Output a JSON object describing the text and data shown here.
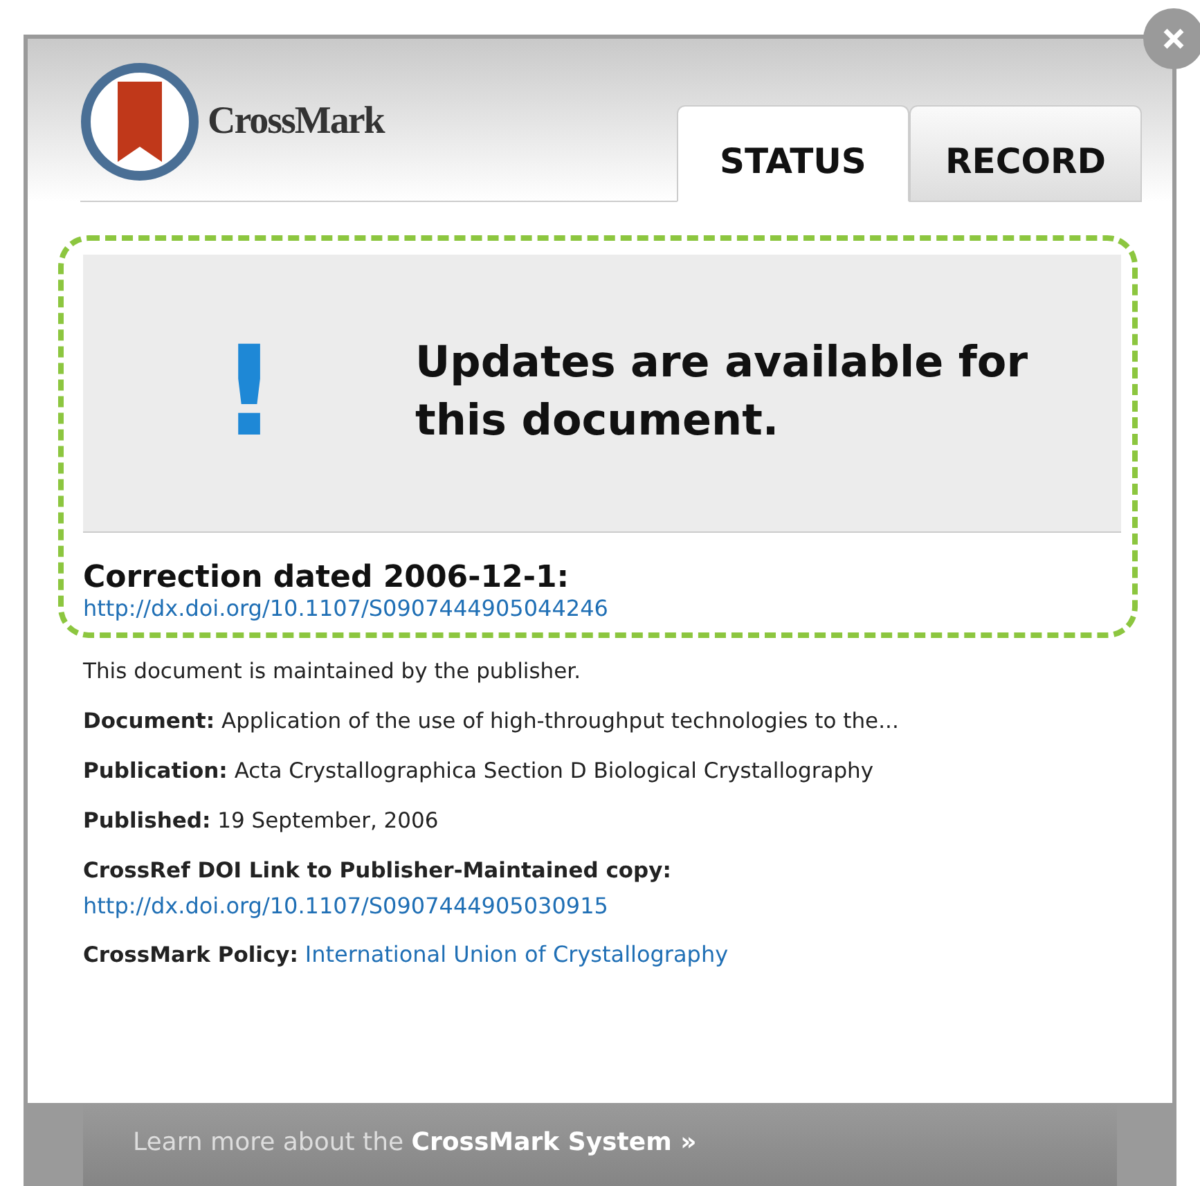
{
  "header": {
    "logo_text": "CrossMark"
  },
  "tabs": [
    {
      "label": "STATUS",
      "selected": true
    },
    {
      "label": "RECORD",
      "selected": false
    }
  ],
  "status": {
    "symbol": "!",
    "message": "Updates are available for this document.",
    "update_label": "Correction dated 2006-12-1:",
    "update_link": "http://dx.doi.org/10.1107/S0907444905044246"
  },
  "details": [
    {
      "kind": "text",
      "text": "This document is maintained by the publisher."
    },
    {
      "kind": "field",
      "label": "Document:",
      "value": "Application of the use of high-throughput technologies to the..."
    },
    {
      "kind": "field",
      "label": "Publication:",
      "value": "Acta Crystallographica Section D Biological Crystallography"
    },
    {
      "kind": "field",
      "label": "Published:",
      "value": "19 September, 2006"
    },
    {
      "kind": "block_link",
      "label": "CrossRef DOI Link to Publisher-Maintained copy:",
      "link": "http://dx.doi.org/10.1107/S0907444905030915"
    },
    {
      "kind": "inline_link",
      "label": "CrossMark Policy:",
      "link": "International Union of Crystallography"
    }
  ],
  "footer": {
    "text": "Learn more about the **CrossMark System »**"
  }
}
